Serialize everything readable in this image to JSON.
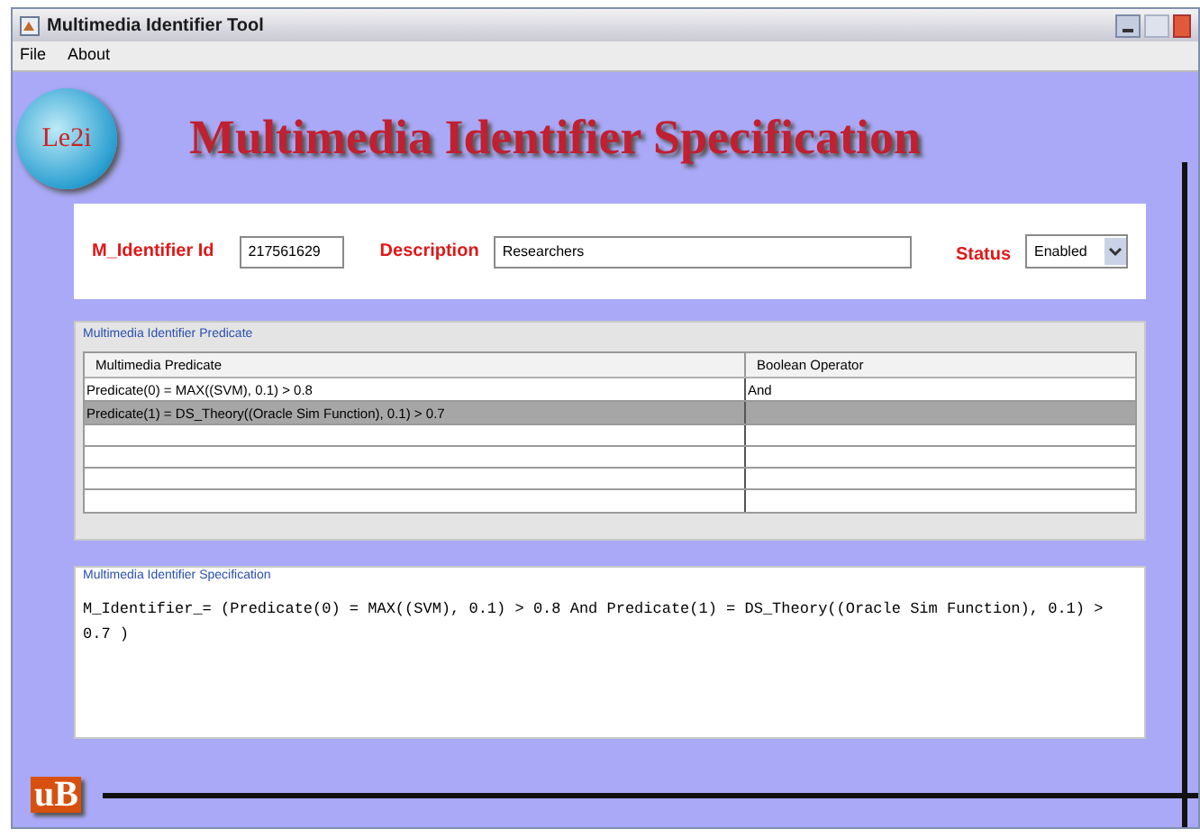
{
  "window": {
    "title": "Multimedia Identifier Tool"
  },
  "menu": [
    "File",
    "About"
  ],
  "logo": {
    "text": "Le2i"
  },
  "heading": "Multimedia Identifier Specification",
  "form": {
    "id_label": "M_Identifier Id",
    "id_value": "217561629",
    "description_label": "Description",
    "description_value": "Researchers",
    "status_label": "Status",
    "status_value": "Enabled"
  },
  "predicate_panel": {
    "title": "Multimedia Identifier Predicate",
    "columns": [
      "Multimedia Predicate",
      "Boolean Operator"
    ],
    "rows": [
      {
        "predicate": "Predicate(0) = MAX((SVM), 0.1) > 0.8",
        "operator": "And",
        "selected": false
      },
      {
        "predicate": "Predicate(1) = DS_Theory((Oracle Sim Function), 0.1) > 0.7",
        "operator": "",
        "selected": true
      }
    ]
  },
  "spec_panel": {
    "title": "Multimedia Identifier Specification",
    "text": "M_Identifier_= (Predicate(0) = MAX((SVM), 0.1) > 0.8 And Predicate(1) = DS_Theory((Oracle Sim Function), 0.1) > 0.7  )"
  },
  "footer_logo": {
    "text": "uB"
  }
}
